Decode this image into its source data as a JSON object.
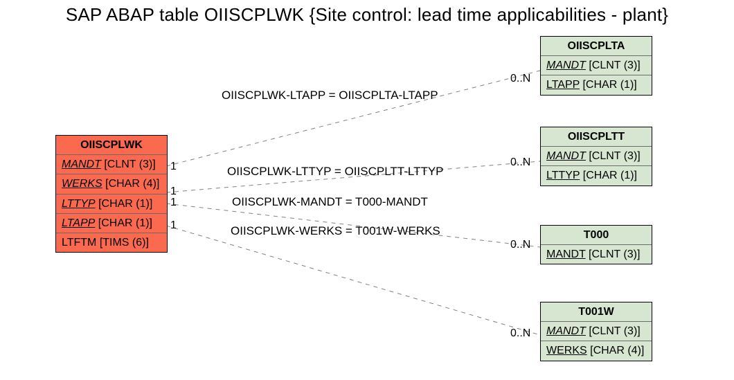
{
  "page_title": "SAP ABAP table OIISCPLWK {Site control: lead time applicabilities - plant}",
  "main_entity": {
    "name": "OIISCPLWK",
    "fields": [
      {
        "name": "MANDT",
        "type": "[CLNT (3)]",
        "key": true
      },
      {
        "name": "WERKS",
        "type": "[CHAR (4)]",
        "key": true
      },
      {
        "name": "LTTYP",
        "type": "[CHAR (1)]",
        "key": true
      },
      {
        "name": "LTAPP",
        "type": "[CHAR (1)]",
        "key": true
      },
      {
        "name": "LTFTM",
        "type": "[TIMS (6)]",
        "key": false
      }
    ]
  },
  "related_entities": [
    {
      "name": "OIISCPLTA",
      "fields": [
        {
          "name": "MANDT",
          "type": "[CLNT (3)]",
          "key": true
        },
        {
          "name": "LTAPP",
          "type": "[CHAR (1)]",
          "key": false
        }
      ]
    },
    {
      "name": "OIISCPLTT",
      "fields": [
        {
          "name": "MANDT",
          "type": "[CLNT (3)]",
          "key": true
        },
        {
          "name": "LTTYP",
          "type": "[CHAR (1)]",
          "key": false
        }
      ]
    },
    {
      "name": "T000",
      "fields": [
        {
          "name": "MANDT",
          "type": "[CLNT (3)]",
          "key": false
        }
      ]
    },
    {
      "name": "T001W",
      "fields": [
        {
          "name": "MANDT",
          "type": "[CLNT (3)]",
          "key": true
        },
        {
          "name": "WERKS",
          "type": "[CHAR (4)]",
          "key": false
        }
      ]
    }
  ],
  "relations": [
    {
      "label": "OIISCPLWK-LTAPP = OIISCPLTA-LTAPP",
      "left_card": "1",
      "right_card": "0..N"
    },
    {
      "label": "OIISCPLWK-LTTYP = OIISCPLTT-LTTYP",
      "left_card": "1",
      "right_card": "0..N"
    },
    {
      "label": "OIISCPLWK-MANDT = T000-MANDT",
      "left_card": "1",
      "right_card": "0..N"
    },
    {
      "label": "OIISCPLWK-WERKS = T001W-WERKS",
      "left_card": "1",
      "right_card": "0..N"
    }
  ]
}
